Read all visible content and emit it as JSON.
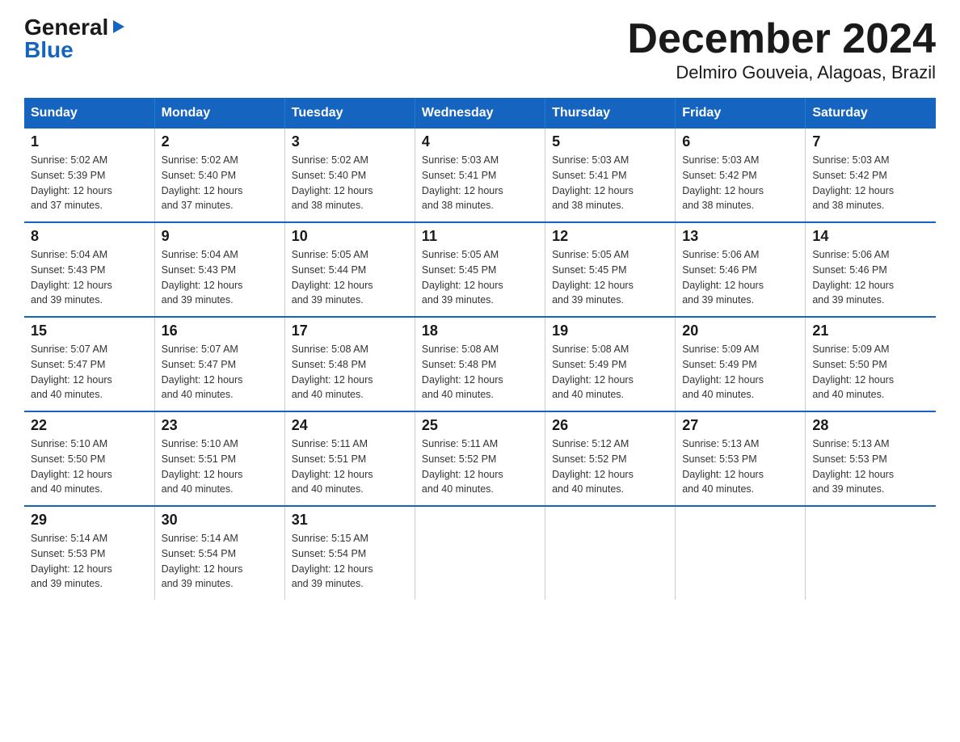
{
  "logo": {
    "line1": "General",
    "line2": "Blue"
  },
  "title": "December 2024",
  "subtitle": "Delmiro Gouveia, Alagoas, Brazil",
  "days_of_week": [
    "Sunday",
    "Monday",
    "Tuesday",
    "Wednesday",
    "Thursday",
    "Friday",
    "Saturday"
  ],
  "weeks": [
    [
      {
        "num": "1",
        "sunrise": "5:02 AM",
        "sunset": "5:39 PM",
        "daylight": "12 hours and 37 minutes."
      },
      {
        "num": "2",
        "sunrise": "5:02 AM",
        "sunset": "5:40 PM",
        "daylight": "12 hours and 37 minutes."
      },
      {
        "num": "3",
        "sunrise": "5:02 AM",
        "sunset": "5:40 PM",
        "daylight": "12 hours and 38 minutes."
      },
      {
        "num": "4",
        "sunrise": "5:03 AM",
        "sunset": "5:41 PM",
        "daylight": "12 hours and 38 minutes."
      },
      {
        "num": "5",
        "sunrise": "5:03 AM",
        "sunset": "5:41 PM",
        "daylight": "12 hours and 38 minutes."
      },
      {
        "num": "6",
        "sunrise": "5:03 AM",
        "sunset": "5:42 PM",
        "daylight": "12 hours and 38 minutes."
      },
      {
        "num": "7",
        "sunrise": "5:03 AM",
        "sunset": "5:42 PM",
        "daylight": "12 hours and 38 minutes."
      }
    ],
    [
      {
        "num": "8",
        "sunrise": "5:04 AM",
        "sunset": "5:43 PM",
        "daylight": "12 hours and 39 minutes."
      },
      {
        "num": "9",
        "sunrise": "5:04 AM",
        "sunset": "5:43 PM",
        "daylight": "12 hours and 39 minutes."
      },
      {
        "num": "10",
        "sunrise": "5:05 AM",
        "sunset": "5:44 PM",
        "daylight": "12 hours and 39 minutes."
      },
      {
        "num": "11",
        "sunrise": "5:05 AM",
        "sunset": "5:45 PM",
        "daylight": "12 hours and 39 minutes."
      },
      {
        "num": "12",
        "sunrise": "5:05 AM",
        "sunset": "5:45 PM",
        "daylight": "12 hours and 39 minutes."
      },
      {
        "num": "13",
        "sunrise": "5:06 AM",
        "sunset": "5:46 PM",
        "daylight": "12 hours and 39 minutes."
      },
      {
        "num": "14",
        "sunrise": "5:06 AM",
        "sunset": "5:46 PM",
        "daylight": "12 hours and 39 minutes."
      }
    ],
    [
      {
        "num": "15",
        "sunrise": "5:07 AM",
        "sunset": "5:47 PM",
        "daylight": "12 hours and 40 minutes."
      },
      {
        "num": "16",
        "sunrise": "5:07 AM",
        "sunset": "5:47 PM",
        "daylight": "12 hours and 40 minutes."
      },
      {
        "num": "17",
        "sunrise": "5:08 AM",
        "sunset": "5:48 PM",
        "daylight": "12 hours and 40 minutes."
      },
      {
        "num": "18",
        "sunrise": "5:08 AM",
        "sunset": "5:48 PM",
        "daylight": "12 hours and 40 minutes."
      },
      {
        "num": "19",
        "sunrise": "5:08 AM",
        "sunset": "5:49 PM",
        "daylight": "12 hours and 40 minutes."
      },
      {
        "num": "20",
        "sunrise": "5:09 AM",
        "sunset": "5:49 PM",
        "daylight": "12 hours and 40 minutes."
      },
      {
        "num": "21",
        "sunrise": "5:09 AM",
        "sunset": "5:50 PM",
        "daylight": "12 hours and 40 minutes."
      }
    ],
    [
      {
        "num": "22",
        "sunrise": "5:10 AM",
        "sunset": "5:50 PM",
        "daylight": "12 hours and 40 minutes."
      },
      {
        "num": "23",
        "sunrise": "5:10 AM",
        "sunset": "5:51 PM",
        "daylight": "12 hours and 40 minutes."
      },
      {
        "num": "24",
        "sunrise": "5:11 AM",
        "sunset": "5:51 PM",
        "daylight": "12 hours and 40 minutes."
      },
      {
        "num": "25",
        "sunrise": "5:11 AM",
        "sunset": "5:52 PM",
        "daylight": "12 hours and 40 minutes."
      },
      {
        "num": "26",
        "sunrise": "5:12 AM",
        "sunset": "5:52 PM",
        "daylight": "12 hours and 40 minutes."
      },
      {
        "num": "27",
        "sunrise": "5:13 AM",
        "sunset": "5:53 PM",
        "daylight": "12 hours and 40 minutes."
      },
      {
        "num": "28",
        "sunrise": "5:13 AM",
        "sunset": "5:53 PM",
        "daylight": "12 hours and 39 minutes."
      }
    ],
    [
      {
        "num": "29",
        "sunrise": "5:14 AM",
        "sunset": "5:53 PM",
        "daylight": "12 hours and 39 minutes."
      },
      {
        "num": "30",
        "sunrise": "5:14 AM",
        "sunset": "5:54 PM",
        "daylight": "12 hours and 39 minutes."
      },
      {
        "num": "31",
        "sunrise": "5:15 AM",
        "sunset": "5:54 PM",
        "daylight": "12 hours and 39 minutes."
      },
      null,
      null,
      null,
      null
    ]
  ],
  "labels": {
    "sunrise": "Sunrise:",
    "sunset": "Sunset:",
    "daylight": "Daylight:"
  },
  "colors": {
    "header_bg": "#1565C0",
    "header_text": "#ffffff",
    "border": "#1565C0"
  }
}
